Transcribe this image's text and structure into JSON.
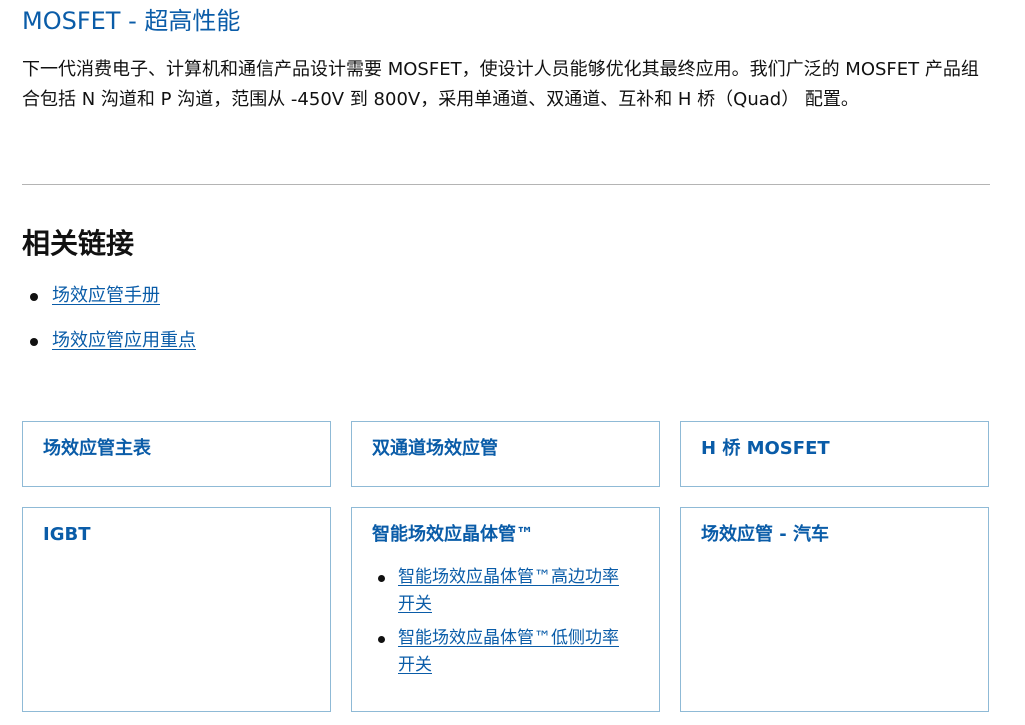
{
  "header": {
    "title": "MOSFET - 超高性能",
    "intro": "下一代消费电子、计算机和通信产品设计需要 MOSFET，使设计人员能够优化其最终应用。我们广泛的 MOSFET 产品组合包括 N 沟道和 P 沟道，范围从 -450V 到 800V，采用单通道、双通道、互补和 H 桥（Quad） 配置。"
  },
  "related_links": {
    "heading": "相关链接",
    "items": [
      {
        "label": "场效应管手册"
      },
      {
        "label": "场效应管应用重点"
      }
    ]
  },
  "cards": [
    {
      "title": "场效应管主表",
      "links": []
    },
    {
      "title": "双通道场效应管",
      "links": []
    },
    {
      "title": "H 桥 MOSFET",
      "links": []
    },
    {
      "title": "IGBT",
      "links": []
    },
    {
      "title": "智能场效应晶体管™",
      "links": [
        {
          "label": "智能场效应晶体管™高边功率开关"
        },
        {
          "label": "智能场效应晶体管™低侧功率开关"
        }
      ]
    },
    {
      "title": "场效应管 - 汽车",
      "links": []
    }
  ],
  "colors": {
    "accent": "#0a5ca8",
    "card_border": "#8fbad6",
    "divider": "#b4b4b4",
    "text": "#111111"
  }
}
